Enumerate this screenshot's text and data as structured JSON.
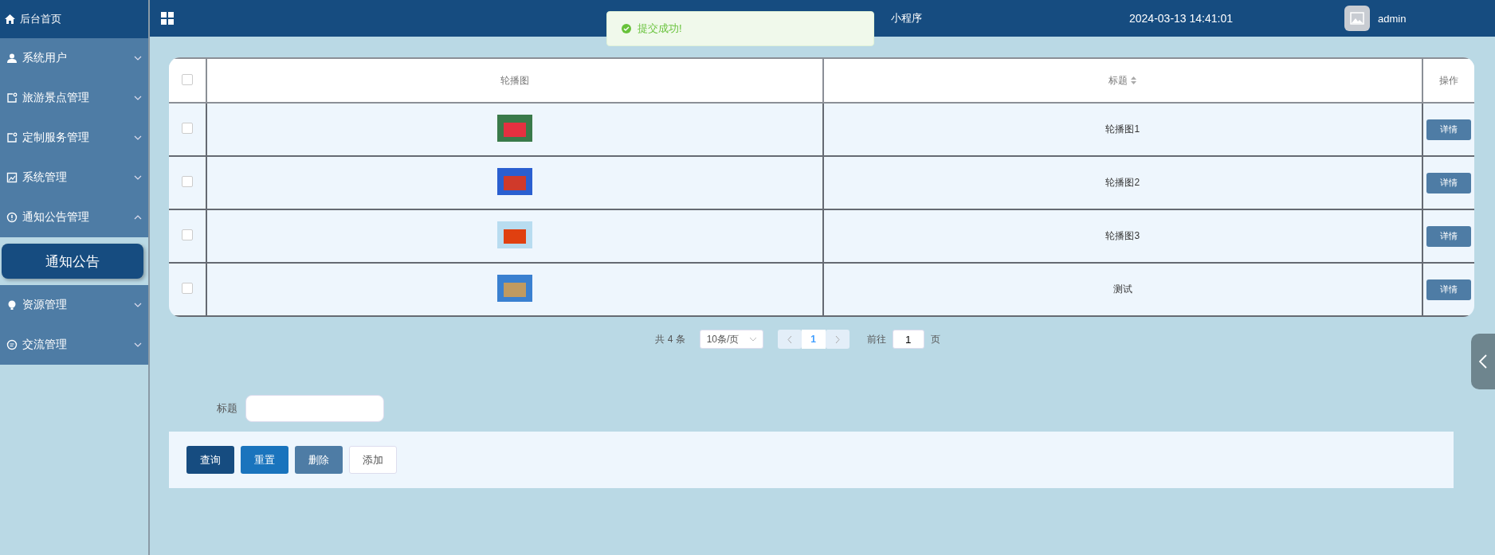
{
  "sidebar": {
    "home": "后台首页",
    "items": [
      {
        "label": "系统用户",
        "expanded": false
      },
      {
        "label": "旅游景点管理",
        "expanded": false
      },
      {
        "label": "定制服务管理",
        "expanded": false
      },
      {
        "label": "系统管理",
        "expanded": false
      },
      {
        "label": "通知公告管理",
        "expanded": true,
        "children": [
          {
            "label": "通知公告",
            "selected": true
          }
        ]
      },
      {
        "label": "资源管理",
        "expanded": false
      },
      {
        "label": "交流管理",
        "expanded": false
      }
    ]
  },
  "header": {
    "title": "小程序",
    "datetime": "2024-03-13 14:41:01",
    "user": "admin"
  },
  "toast": {
    "message": "提交成功!"
  },
  "table": {
    "all_checked": false,
    "columns": [
      "轮播图",
      "标题",
      "操作"
    ],
    "rows": [
      {
        "title": "轮播图1",
        "action": "详情",
        "checked": false
      },
      {
        "title": "轮播图2",
        "action": "详情",
        "checked": false
      },
      {
        "title": "轮播图3",
        "action": "详情",
        "checked": false
      },
      {
        "title": "测试",
        "action": "详情",
        "checked": false
      }
    ]
  },
  "pagination": {
    "total": "共 4 条",
    "page_size": "10条/页",
    "pages": [
      {
        "label": "1",
        "selected": true
      }
    ],
    "goto_label": "前往",
    "goto_value": "1",
    "goto_suffix": "页"
  },
  "search": {
    "label": "标题"
  },
  "buttons": [
    {
      "label": "查询",
      "kind": "primary"
    },
    {
      "label": "重置",
      "kind": "info"
    },
    {
      "label": "删除",
      "kind": "muted"
    },
    {
      "label": "添加",
      "kind": "plain"
    }
  ]
}
